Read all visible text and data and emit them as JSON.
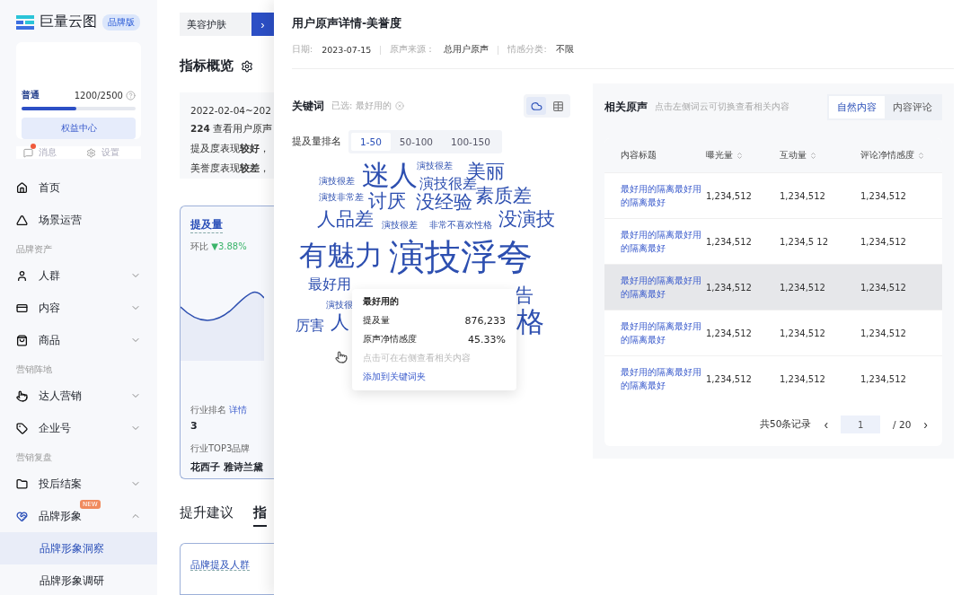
{
  "sidebar": {
    "logo": "巨量云图",
    "edition": "品牌版",
    "account": {
      "tier": "普通",
      "quota": "1200/2500",
      "level": 0.48,
      "button": "权益中心"
    },
    "actions": [
      {
        "label": "消息",
        "unread": true
      },
      {
        "label": "设置",
        "unread": false
      }
    ],
    "nav": [
      {
        "kind": "item",
        "label": "首页",
        "selected": false
      },
      {
        "kind": "item",
        "label": "场景运营",
        "selected": false
      },
      {
        "kind": "section",
        "label": "品牌资产"
      },
      {
        "kind": "item",
        "label": "人群",
        "selected": false,
        "expanded": false
      },
      {
        "kind": "item",
        "label": "内容",
        "selected": false,
        "expanded": false
      },
      {
        "kind": "item",
        "label": "商品",
        "selected": false,
        "expanded": false
      },
      {
        "kind": "section",
        "label": "营销阵地"
      },
      {
        "kind": "item",
        "label": "达人营销",
        "selected": false,
        "expanded": false
      },
      {
        "kind": "item",
        "label": "企业号",
        "selected": false,
        "expanded": false
      },
      {
        "kind": "section",
        "label": "营销复盘"
      },
      {
        "kind": "item",
        "label": "投后结案",
        "selected": false,
        "expanded": false
      },
      {
        "kind": "item",
        "label": "品牌形象",
        "selected": false,
        "expanded": true,
        "badge": "NEW",
        "children": [
          {
            "label": "品牌形象洞察",
            "selected": true
          },
          {
            "label": "品牌形象调研",
            "selected": false
          }
        ]
      }
    ]
  },
  "main": {
    "category": "美容护肤",
    "next": "›",
    "title": "指标概览",
    "summary": [
      "2022-02-04~202",
      "**224** 查看用户原声",
      "提及度表现**较好**，",
      "美誉度表现**较差**，"
    ],
    "card": {
      "title": "提及量",
      "compare": "环比",
      "change": "▼3.88%",
      "rank_label": "行业排名",
      "rank_link": "详情",
      "rank": "3",
      "top_label": "行业TOP3品牌",
      "top_brands": "花西子 雅诗兰黛"
    },
    "tabs": [
      {
        "label": "提升建议",
        "selected": false
      },
      {
        "label": "指",
        "selected": true
      }
    ],
    "subcard": "品牌提及人群"
  },
  "drawer": {
    "title": "用户原声详情-美誉度",
    "filters": [
      {
        "label": "日期:",
        "value": "2023-07-15"
      },
      {
        "label": "原声来源：",
        "value": "总用户原声"
      },
      {
        "label": "情感分类:",
        "value": "不限"
      }
    ],
    "keywords": {
      "title": "关键词",
      "picked_label": "已选:",
      "picked": "最好用的",
      "views": [
        {
          "kind": "cloud",
          "selected": true
        },
        {
          "kind": "table",
          "selected": false
        }
      ],
      "rank_label": "提及量排名",
      "ranges": [
        {
          "label": "1-50",
          "selected": true
        },
        {
          "label": "50-100",
          "selected": false
        },
        {
          "label": "100-150",
          "selected": false
        }
      ],
      "words": [
        {
          "text": "迷人",
          "kind": "large"
        },
        {
          "text": "演技很差",
          "kind": "tiny"
        },
        {
          "text": "演技很差",
          "kind": "tiny"
        },
        {
          "text": "演技很差",
          "kind": "small"
        },
        {
          "text": "美丽",
          "kind": "medium"
        },
        {
          "text": "演技非常差",
          "kind": "tiny"
        },
        {
          "text": "讨厌",
          "kind": "medium"
        },
        {
          "text": "没经验",
          "kind": "medium"
        },
        {
          "text": "素质差",
          "kind": "medium"
        },
        {
          "text": "人品差",
          "kind": "medium"
        },
        {
          "text": "演技很差",
          "kind": "tiny"
        },
        {
          "text": "非常不喜欢性格",
          "kind": "tiny"
        },
        {
          "text": "没演技",
          "kind": "medium"
        },
        {
          "text": "有魅力",
          "kind": "large"
        },
        {
          "text": "演技浮夸",
          "kind": "huge"
        },
        {
          "text": "最好用",
          "kind": "small"
        },
        {
          "text": "演技很",
          "kind": "tiny"
        },
        {
          "text": "厉害",
          "kind": "small"
        },
        {
          "text": "人",
          "kind": "medium"
        },
        {
          "text": "告",
          "kind": "medium"
        },
        {
          "text": "格",
          "kind": "large"
        }
      ],
      "tooltip": {
        "title": "最好用的",
        "rows": [
          {
            "label": "提及量",
            "value": "876,233"
          },
          {
            "label": "原声净情感度",
            "value": "45.33%"
          }
        ],
        "hint": "点击可在右侧查看相关内容",
        "action": "添加到关键词夹"
      }
    },
    "related": {
      "title": "相关原声",
      "hint": "点击左侧词云可切换查看相关内容",
      "tabs": [
        {
          "label": "自然内容",
          "selected": true
        },
        {
          "label": "内容评论",
          "selected": false
        }
      ],
      "columns": [
        {
          "label": "内容标题",
          "sortable": false
        },
        {
          "label": "曝光量",
          "sortable": true
        },
        {
          "label": "互动量",
          "sortable": true
        },
        {
          "label": "评论净情感度",
          "sortable": true
        }
      ],
      "rows": [
        {
          "cells": [
            "最好用的隔离最好用的隔离最好",
            "1,234,512",
            "1,234,512",
            "1,234,512"
          ],
          "hovered": false
        },
        {
          "cells": [
            "最好用的隔离最好用的隔离最好",
            "1,234,512",
            "1,234,5 12",
            "1,234,512"
          ],
          "hovered": false
        },
        {
          "cells": [
            "最好用的隔离最好用的隔离最好",
            "1,234,512",
            "1,234,512",
            "1,234,512"
          ],
          "hovered": true
        },
        {
          "cells": [
            "最好用的隔离最好用的隔离最好",
            "1,234,512",
            "1,234,512",
            "1,234,512"
          ],
          "hovered": false
        },
        {
          "cells": [
            "最好用的隔离最好用的隔离最好",
            "1,234,512",
            "1,234,512",
            "1,234,512"
          ],
          "hovered": false
        }
      ],
      "pagination": {
        "total": "共50条记录",
        "prev": "‹",
        "page": "1",
        "pages": "/ 20",
        "next": "›"
      }
    }
  }
}
